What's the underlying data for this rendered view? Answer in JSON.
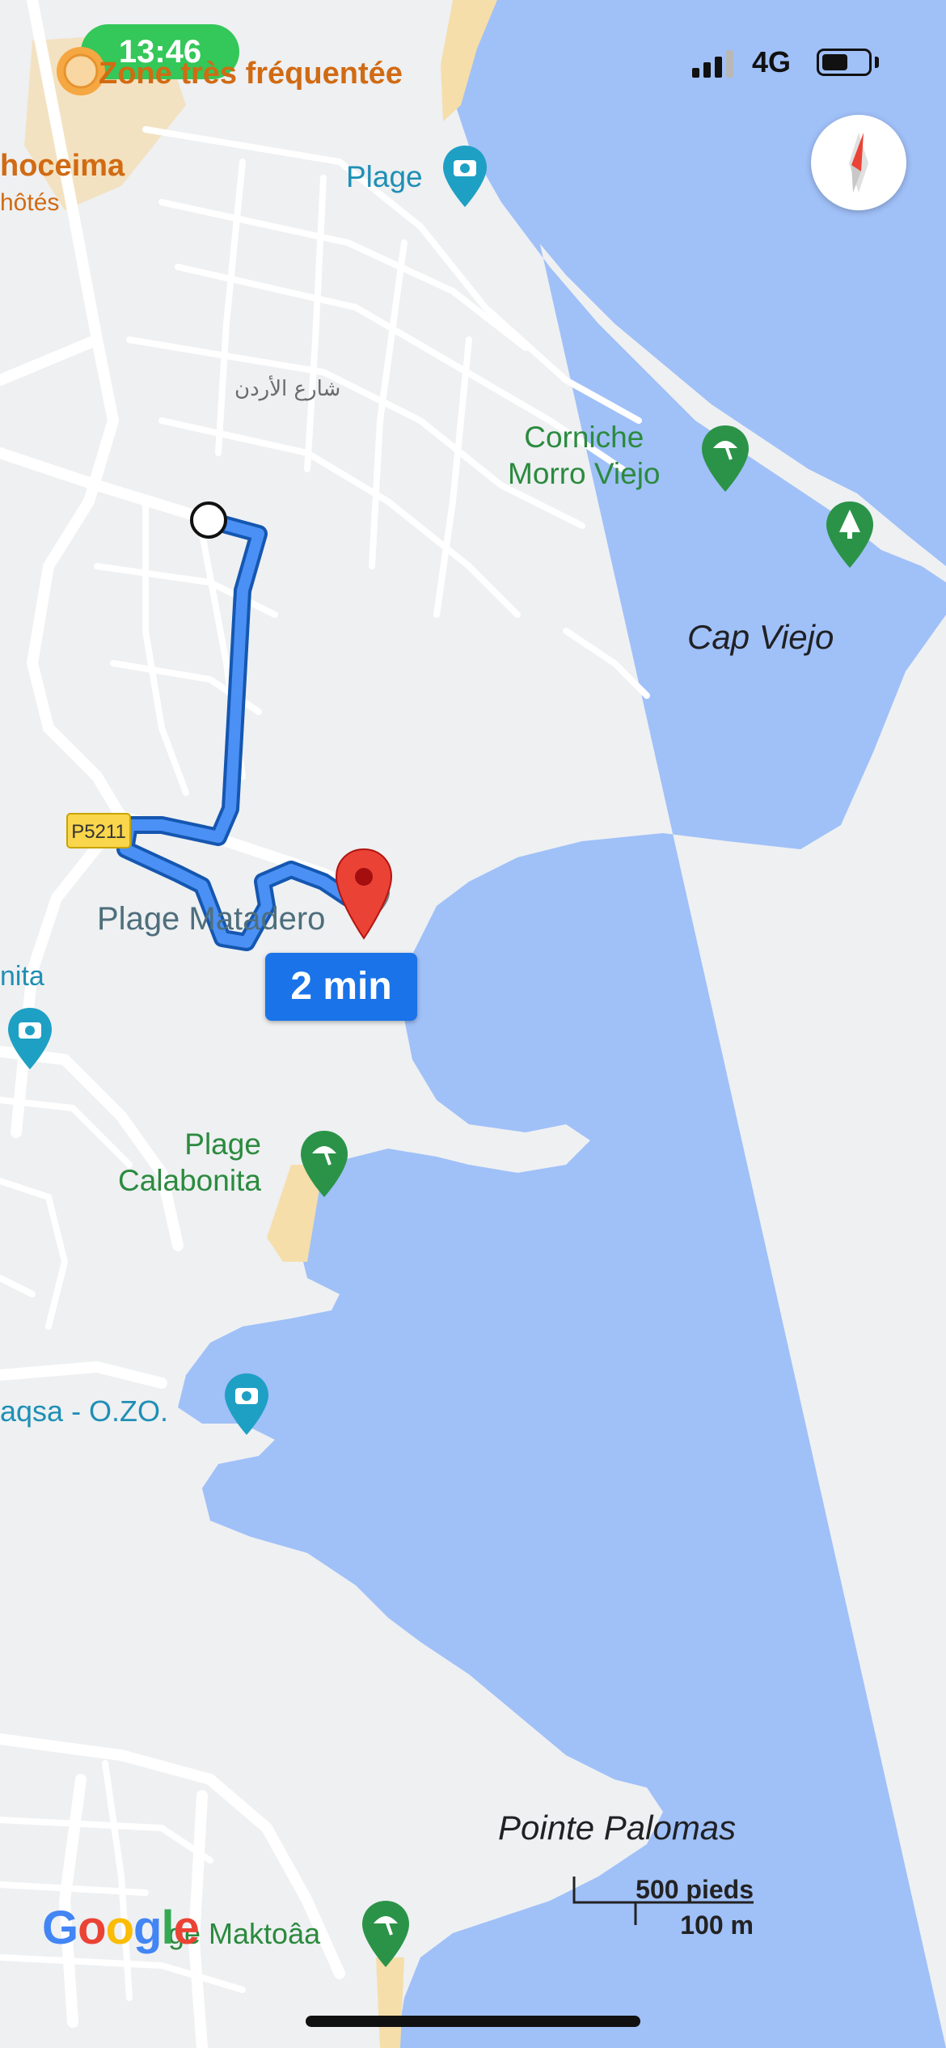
{
  "status_bar": {
    "time": "13:46",
    "network": "4G",
    "battery_level": 0.55
  },
  "map": {
    "busy_area": "Zone très fréquentée",
    "city_partial": "hoceima",
    "hotels_partial": "hôtés",
    "street_arabic": "شارع الأردن",
    "plage_top": "Plage",
    "corniche_line1": "Corniche",
    "corniche_line2": "Morro Viejo",
    "cap_viejo": "Cap Viejo",
    "road_shield": "P5211",
    "destination": "Plage Matadero",
    "left_partial": "nita",
    "calabonita_line1": "Plage",
    "calabonita_line2": "Calabonita",
    "aqsa": "aqsa - O.ZO.",
    "pointe": "Pointe Palomas",
    "maktoaa": "ge Maktoâa",
    "scale_feet": "500 pieds",
    "scale_m": "100 m",
    "google_letters": [
      "G",
      "o",
      "o",
      "g",
      "l",
      "e"
    ],
    "google_colors": [
      "#4285F4",
      "#EA4335",
      "#FBBC05",
      "#4285F4",
      "#34A853",
      "#EA4335"
    ]
  },
  "route": {
    "duration": "2 min",
    "color": "#1a73e8"
  },
  "colors": {
    "water": "#a0c0f8",
    "land": "#eef0f2",
    "road": "#ffffff",
    "beach": "#f5deaa",
    "pin_red": "#ea4335",
    "poi_green": "#2b8a3e"
  }
}
